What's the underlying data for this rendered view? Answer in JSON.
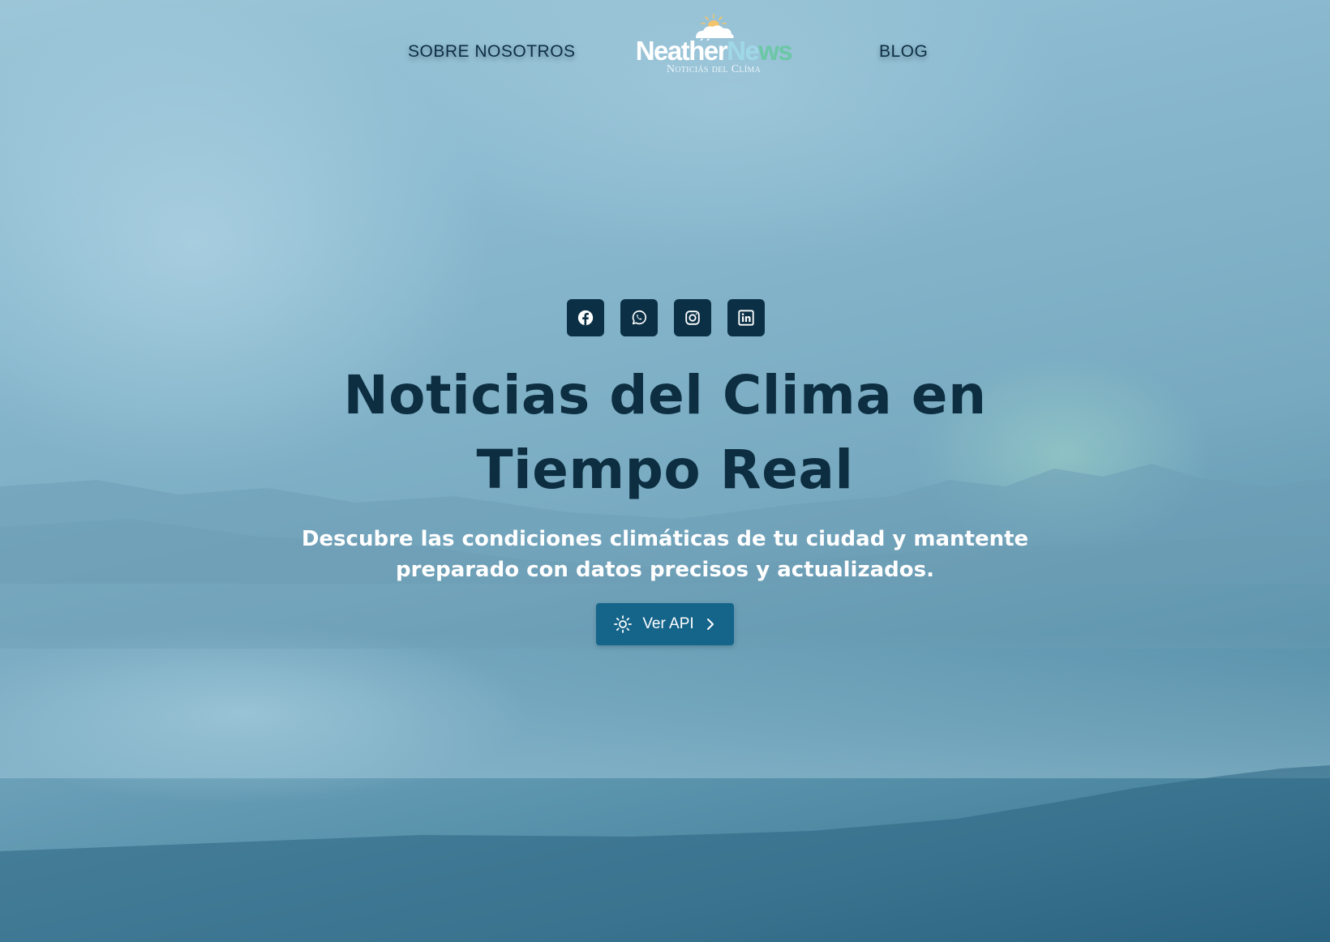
{
  "nav": {
    "left_link": "SOBRE NOSOTROS",
    "right_link": "BLOG"
  },
  "logo": {
    "name_part1": "Neather",
    "name_part2": "Ne",
    "name_part3": "ws",
    "tagline": "Noticiás del Clíma"
  },
  "social": {
    "items": [
      {
        "icon": "facebook-icon"
      },
      {
        "icon": "whatsapp-icon"
      },
      {
        "icon": "instagram-icon"
      },
      {
        "icon": "linkedin-icon"
      }
    ],
    "button_color": "#0b3046"
  },
  "hero": {
    "title": "Noticias del Clima en Tiempo Real",
    "subtitle": "Descubre las condiciones climáticas de tu ciudad y mantente preparado con datos precisos y actualizados.",
    "cta_label": "Ver API",
    "cta_icons": [
      "sun-icon",
      "chevron-right-icon"
    ],
    "cta_color": "#15648a"
  },
  "colors": {
    "title": "#0d2e41",
    "subtitle": "#ffffff",
    "logo_accent_blue": "#9fd8e8",
    "logo_accent_green": "#6bc7a6"
  }
}
